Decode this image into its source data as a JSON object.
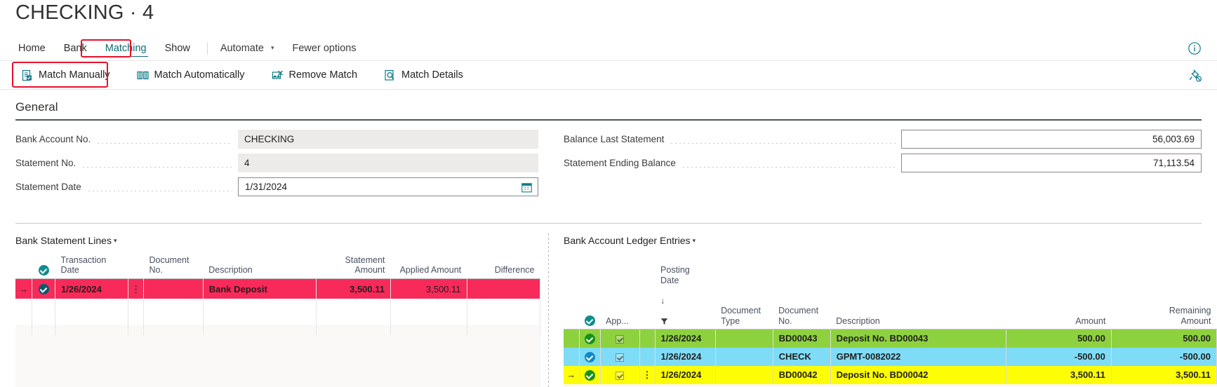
{
  "header": {
    "title": "CHECKING · 4",
    "info_icon": "info-icon",
    "unpin_icon": "unpin-icon"
  },
  "menu": {
    "items": [
      {
        "label": "Home",
        "active": false
      },
      {
        "label": "Bank",
        "active": false
      },
      {
        "label": "Matching",
        "active": true
      },
      {
        "label": "Show",
        "active": false
      }
    ],
    "automate": "Automate",
    "fewer_options": "Fewer options"
  },
  "ribbon": {
    "buttons": [
      {
        "label": "Match Manually",
        "icon": "match-manually-icon"
      },
      {
        "label": "Match Automatically",
        "icon": "match-automatically-icon"
      },
      {
        "label": "Remove Match",
        "icon": "remove-match-icon"
      },
      {
        "label": "Match Details",
        "icon": "match-details-icon"
      }
    ]
  },
  "general": {
    "section_title": "General",
    "left_fields": [
      {
        "label": "Bank Account No.",
        "value": "CHECKING"
      },
      {
        "label": "Statement No.",
        "value": "4"
      },
      {
        "label": "Statement Date",
        "value": "1/31/2024"
      }
    ],
    "right_fields": [
      {
        "label": "Balance Last Statement",
        "value": "56,003.69"
      },
      {
        "label": "Statement Ending Balance",
        "value": "71,113.54"
      }
    ]
  },
  "bank_statement_lines": {
    "caption": "Bank Statement Lines",
    "columns": [
      "Transaction\nDate",
      "Document\nNo.",
      "Description",
      "Statement\nAmount",
      "Applied Amount",
      "Difference"
    ],
    "rows": [
      {
        "selected": true,
        "highlight": "pink",
        "arrow": "→",
        "transaction_date": "1/26/2024",
        "document_no": "",
        "description": "Bank Deposit",
        "statement_amount": "3,500.11",
        "applied_amount": "3,500.11",
        "difference": ""
      }
    ]
  },
  "bank_account_ledger_entries": {
    "caption": "Bank Account Ledger Entries",
    "columns": [
      "App...",
      "Posting Date",
      "Document\nType",
      "Document\nNo.",
      "Description",
      "Amount",
      "Remaining\nAmount"
    ],
    "rows": [
      {
        "highlight": "green",
        "arrow": "",
        "applied": true,
        "posting_date": "1/26/2024",
        "document_type": "",
        "document_no": "BD00043",
        "description": "Deposit No. BD00043",
        "amount": "500.00",
        "remaining_amount": "500.00"
      },
      {
        "highlight": "blue",
        "arrow": "",
        "applied": true,
        "posting_date": "1/26/2024",
        "document_type": "",
        "document_no": "CHECK",
        "description": "GPMT-0082022",
        "amount": "-500.00",
        "remaining_amount": "-500.00"
      },
      {
        "highlight": "yellow",
        "arrow": "→",
        "applied": true,
        "posting_date": "1/26/2024",
        "document_type": "",
        "document_no": "BD00042",
        "description": "Deposit No. BD00042",
        "amount": "3,500.11",
        "remaining_amount": "3,500.11"
      }
    ]
  },
  "colors": {
    "accent_teal": "#0f6c75",
    "highlight_red": "#e8112d",
    "row_pink": "#f72a5a",
    "row_green": "#8ed13f",
    "row_blue": "#7fdcf7",
    "row_yellow": "#fdfd06"
  }
}
